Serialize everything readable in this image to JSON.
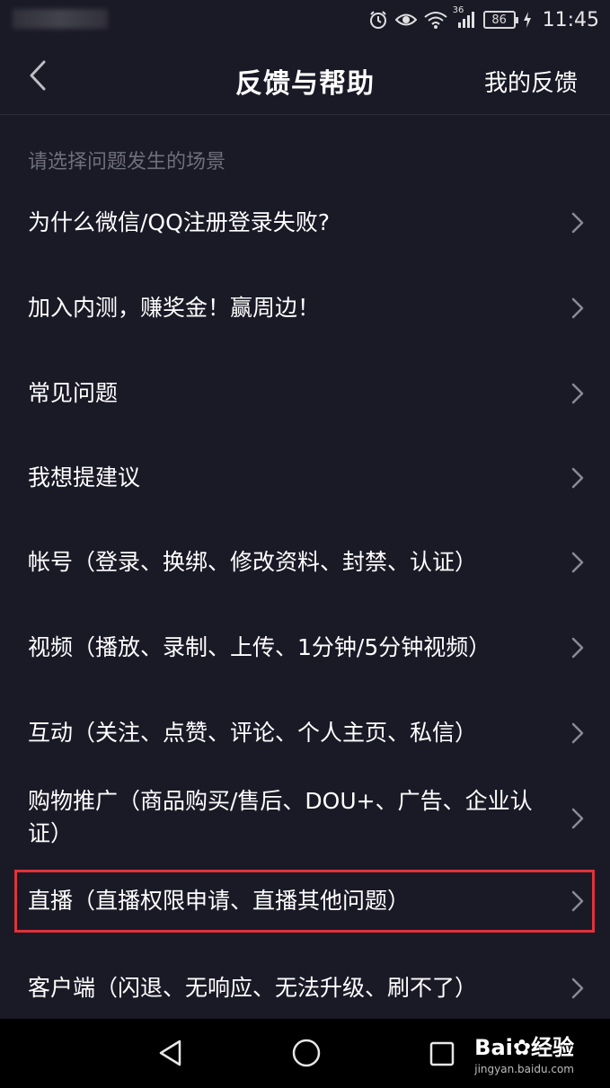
{
  "status_bar": {
    "network": "36",
    "battery": "86",
    "time": "11:45"
  },
  "header": {
    "title": "反馈与帮助",
    "right_action": "我的反馈"
  },
  "section_hint": "请选择问题发生的场景",
  "menu": [
    {
      "label": "为什么微信/QQ注册登录失败?"
    },
    {
      "label": "加入内测，赚奖金！赢周边！"
    },
    {
      "label": "常见问题"
    },
    {
      "label": "我想提建议"
    },
    {
      "label": "帐号（登录、换绑、修改资料、封禁、认证）"
    },
    {
      "label": "视频（播放、录制、上传、1分钟/5分钟视频）"
    },
    {
      "label": "互动（关注、点赞、评论、个人主页、私信）"
    },
    {
      "label": "购物推广（商品购买/售后、DOU+、广告、企业认证）"
    },
    {
      "label": "直播（直播权限申请、直播其他问题）"
    },
    {
      "label": "客户端（闪退、无响应、无法升级、刷不了）"
    }
  ],
  "watermark": {
    "logo_text": "Bai",
    "logo_suffix": "经验",
    "url": "jingyan.baidu.com"
  },
  "colors": {
    "background": "#1a1926",
    "highlight": "#e0323a",
    "hint": "#6f6e7a",
    "chevron": "#8a8a94"
  },
  "icons": [
    "back-arrow-icon",
    "chevron-right-icon",
    "alarm-icon",
    "eye-icon",
    "wifi-icon",
    "signal-icon",
    "battery-icon",
    "charging-icon",
    "nav-back-icon",
    "nav-home-icon",
    "nav-recent-icon"
  ]
}
